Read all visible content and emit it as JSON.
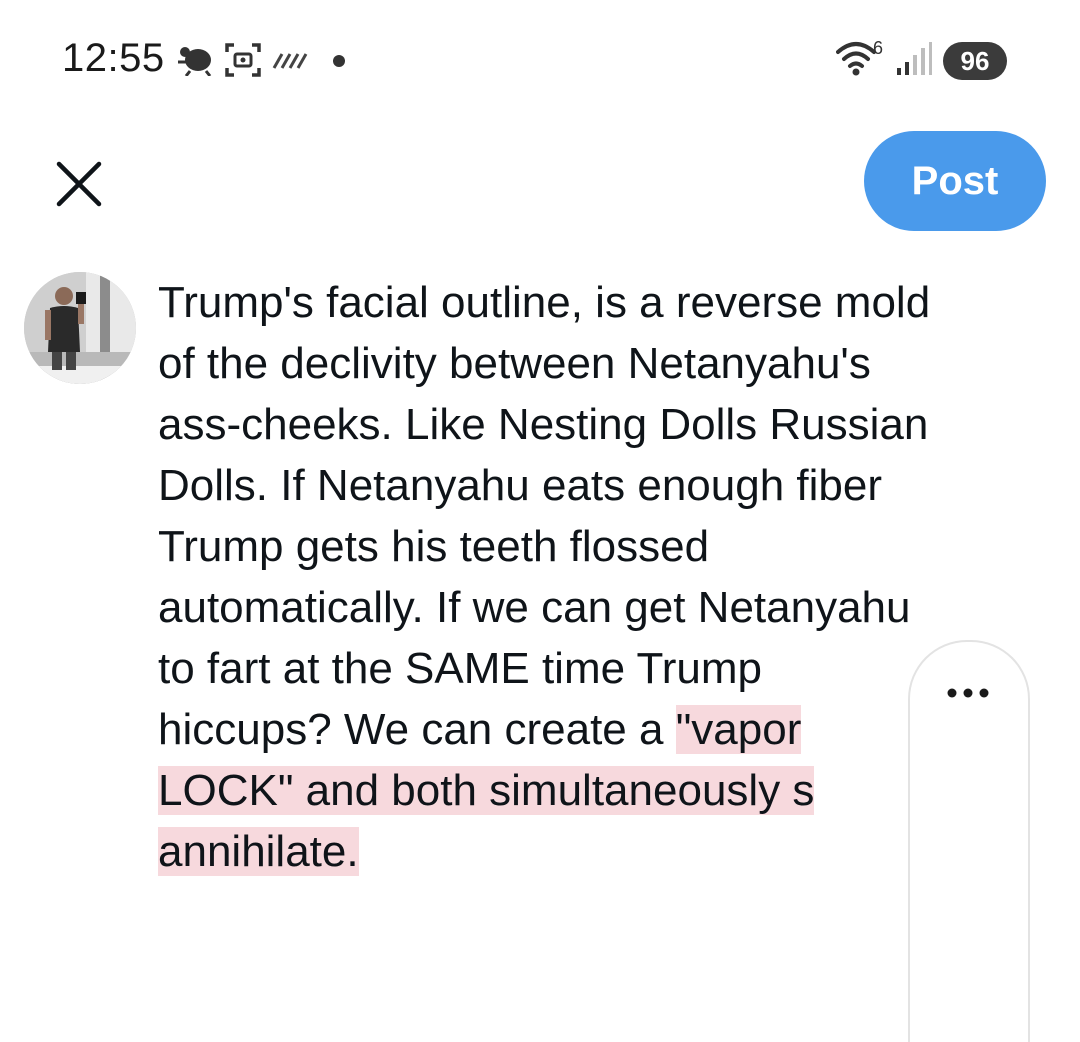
{
  "status_bar": {
    "time": "12:55",
    "icons": [
      "bug-notification-icon",
      "screenshot-icon",
      "data-saver-icon",
      "notification-dot"
    ],
    "wifi_superscript": "6",
    "battery": "96"
  },
  "compose": {
    "close_icon": "close-icon",
    "post_label": "Post",
    "post_color": "#4a9aeb",
    "text_before_highlight": "Trump's facial outline, is a reverse mold\nof the declivity between Netanyahu's\nass-cheeks. Like Nesting Dolls Russian\nDolls. If Netanyahu eats enough fiber\nTrump gets his teeth flossed\nautomatically. If we can get Netanyahu\nto fart at the SAME time Trump\nhiccups? We can create a ",
    "text_highlighted": "\"vapor\nLOCK\" and both simultaneously s\nannihilate.",
    "highlight_color": "#f7d9dd"
  },
  "text_selection_menu": {
    "icon": "more-options-icon"
  }
}
